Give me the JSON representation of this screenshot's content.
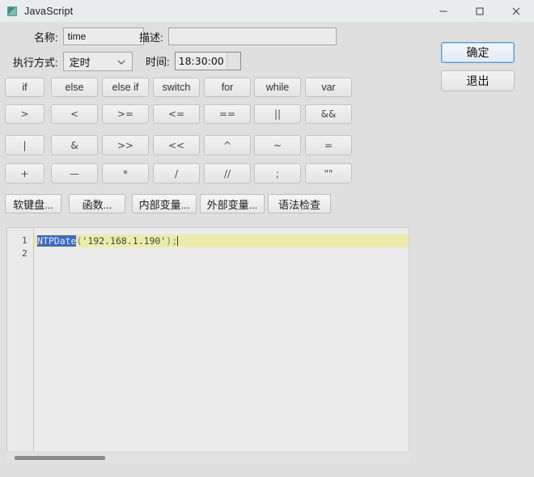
{
  "window": {
    "title": "JavaScript",
    "icon": "javascript-icon",
    "controls": {
      "minimize": "minimize-icon",
      "maximize": "maximize-icon",
      "close": "close-icon"
    }
  },
  "form": {
    "name_label": "名称:",
    "name_value": "time",
    "desc_label": "描述:",
    "desc_value": "",
    "desc_placeholder": "",
    "mode_label": "执行方式:",
    "mode_value": "定时",
    "mode_options": [
      "定时"
    ],
    "time_label": "时间:",
    "time_value": "18:30:00"
  },
  "side_buttons": {
    "confirm": "确定",
    "exit": "退出"
  },
  "keypad": {
    "row1": [
      "if",
      "else",
      "else if",
      "switch",
      "for",
      "while",
      "var"
    ],
    "row2": [
      ">",
      "<",
      ">=",
      "<=",
      "==",
      "||",
      "&&"
    ],
    "row3": [
      "|",
      "&",
      ">>",
      "<<",
      "^",
      "~",
      "="
    ],
    "row4": [
      "+",
      "—",
      "*",
      "/",
      "//",
      ";",
      "\"\""
    ]
  },
  "tool_buttons": [
    "软键盘...",
    "函数...",
    "内部变量...",
    "外部变量...",
    "语法检查"
  ],
  "editor": {
    "line_numbers": [
      "1",
      "2"
    ],
    "lines": [
      {
        "selected_text": "NTPDate",
        "open_paren": "(",
        "string_literal": "'192.168.1.190'",
        "close_paren": ")",
        "semicolon": ";"
      },
      {
        "text": ""
      }
    ]
  },
  "colors": {
    "window_bg": "#dfdfdf",
    "titlebar": "#e9eced",
    "editor_bg": "#ececec",
    "current_line": "#ecebab",
    "selection": "#3b6bbf",
    "focus_border": "#5b9bd5"
  }
}
